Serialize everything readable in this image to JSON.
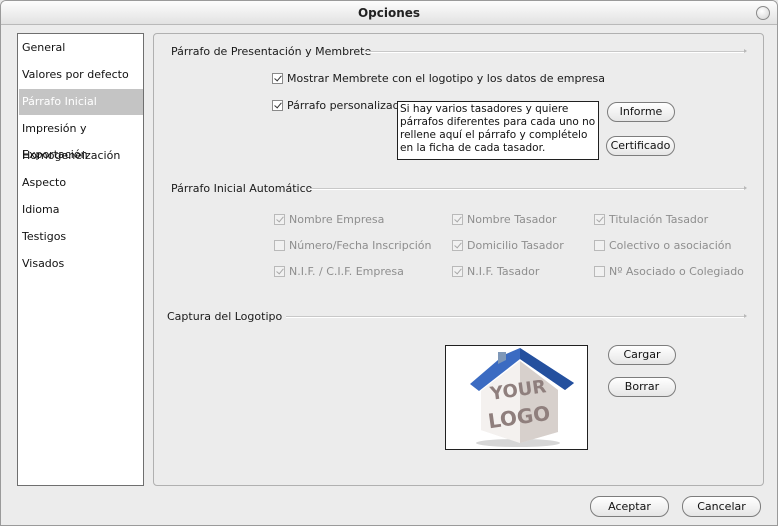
{
  "window": {
    "title": "Opciones"
  },
  "sidebar": {
    "items": [
      {
        "label": "General",
        "selected": false
      },
      {
        "label": "Valores por defecto",
        "selected": false
      },
      {
        "label": "Párrafo Inicial",
        "selected": true
      },
      {
        "label": "Impresión y Exportación",
        "selected": false
      },
      {
        "label": "Homogeneización",
        "selected": false
      },
      {
        "label": "Aspecto",
        "selected": false
      },
      {
        "label": "Idioma",
        "selected": false
      },
      {
        "label": "Testigos",
        "selected": false
      },
      {
        "label": "Visados",
        "selected": false
      }
    ]
  },
  "presentation": {
    "title": "Párrafo de Presentación y Membrete",
    "show_letterhead": {
      "label": "Mostrar Membrete con el logotipo y los datos de empresa",
      "checked": true
    },
    "custom_paragraph": {
      "label": "Párrafo personalizado",
      "checked": true
    },
    "note": "Si hay varios tasadores y quiere párrafos diferentes para cada uno no rellene aquí el párrafo y complételo en la ficha de cada tasador.",
    "report_button": "Informe",
    "certificate_button": "Certificado"
  },
  "automatic": {
    "title": "Párrafo Inicial Automático",
    "options": [
      {
        "label": "Nombre Empresa",
        "checked": true
      },
      {
        "label": "Nombre Tasador",
        "checked": true
      },
      {
        "label": "Titulación Tasador",
        "checked": true
      },
      {
        "label": "Número/Fecha Inscripción",
        "checked": false
      },
      {
        "label": "Domicilio Tasador",
        "checked": true
      },
      {
        "label": "Colectivo o asociación",
        "checked": false
      },
      {
        "label": "N.I.F. / C.I.F. Empresa",
        "checked": true
      },
      {
        "label": "N.I.F. Tasador",
        "checked": true
      },
      {
        "label": "Nº Asociado o Colegiado",
        "checked": false
      }
    ]
  },
  "logo": {
    "title": "Captura del Logotipo",
    "image_text": [
      "YOUR",
      "LOGO"
    ],
    "load_button": "Cargar",
    "delete_button": "Borrar"
  },
  "footer": {
    "accept_button": "Aceptar",
    "cancel_button": "Cancelar"
  }
}
